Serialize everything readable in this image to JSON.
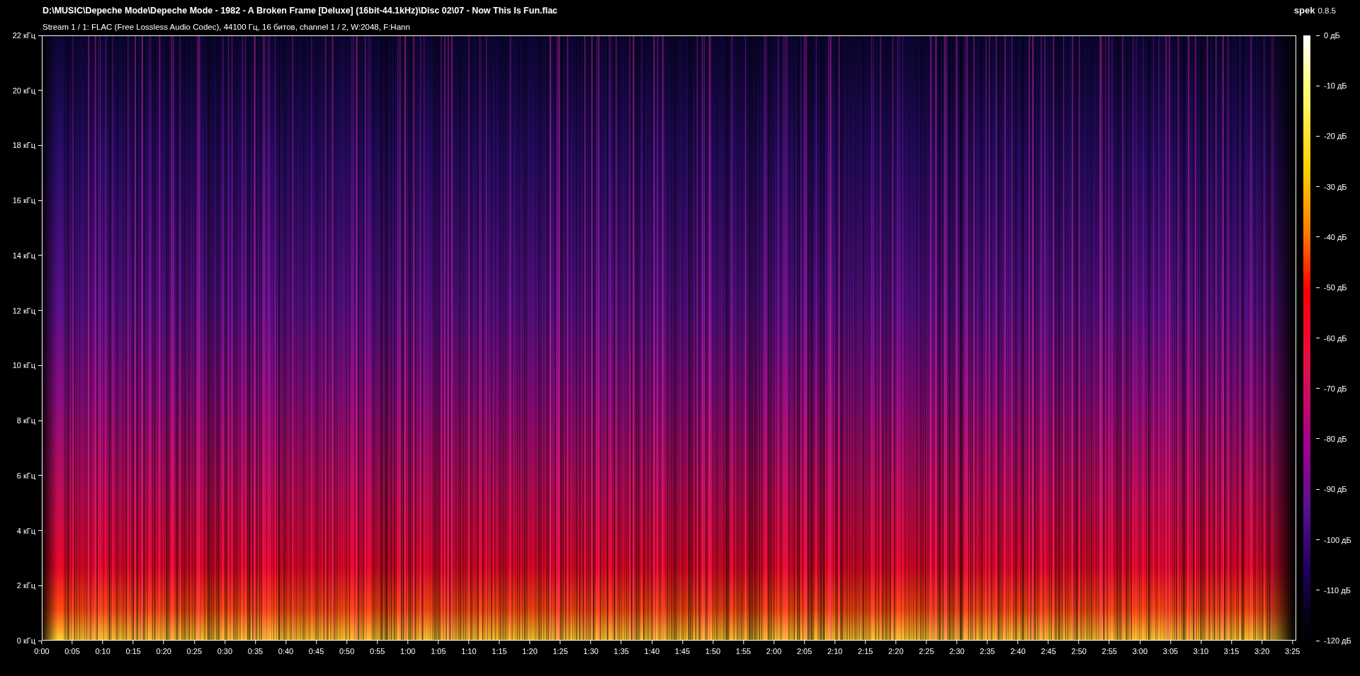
{
  "window": {
    "title": "D:\\MUSIC\\Depeche Mode\\Depeche Mode - 1982 - A Broken Frame [Deluxe] (16bit-44.1kHz)\\Disc 02\\07 - Now This Is Fun.flac",
    "app_name": "spek",
    "app_version": "0.8.5"
  },
  "stream_info": "Stream 1 / 1: FLAC (Free Lossless Audio Codec), 44100 Гц, 16 битов, channel 1 / 2, W:2048, F:Hann",
  "frequency_axis": {
    "ticks": [
      "22 кГц",
      "20 кГц",
      "18 кГц",
      "16 кГц",
      "14 кГц",
      "12 кГц",
      "10 кГц",
      "8 кГц",
      "6 кГц",
      "4 кГц",
      "2 кГц",
      "0 кГц"
    ]
  },
  "time_axis": {
    "ticks": [
      "0:00",
      "0:05",
      "0:10",
      "0:15",
      "0:20",
      "0:25",
      "0:30",
      "0:35",
      "0:40",
      "0:45",
      "0:50",
      "0:55",
      "1:00",
      "1:05",
      "1:10",
      "1:15",
      "1:20",
      "1:25",
      "1:30",
      "1:35",
      "1:40",
      "1:45",
      "1:50",
      "1:55",
      "2:00",
      "2:05",
      "2:10",
      "2:15",
      "2:20",
      "2:25",
      "2:30",
      "2:35",
      "2:40",
      "2:45",
      "2:50",
      "2:55",
      "3:00",
      "3:05",
      "3:10",
      "3:15",
      "3:20",
      "3:25"
    ]
  },
  "level_legend": {
    "ticks": [
      "0 дБ",
      "-10 дБ",
      "-20 дБ",
      "-30 дБ",
      "-40 дБ",
      "-50 дБ",
      "-60 дБ",
      "-70 дБ",
      "-80 дБ",
      "-90 дБ",
      "-100 дБ",
      "-110 дБ",
      "-120 дБ"
    ]
  }
}
